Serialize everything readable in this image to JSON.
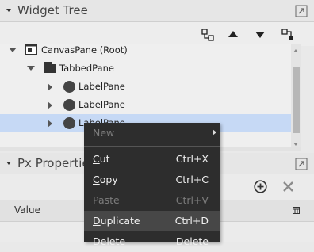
{
  "widget_tree": {
    "title": "Widget Tree",
    "toolbar_icons": [
      "expand-collapse-icon",
      "move-up-icon",
      "move-down-icon",
      "reorder-icon"
    ],
    "nodes": [
      {
        "label": "CanvasPane (Root)",
        "icon": "canvas-pane-icon",
        "expanded": true
      },
      {
        "label": "TabbedPane",
        "icon": "tabbed-pane-icon",
        "expanded": true
      },
      {
        "label": "LabelPane",
        "icon": "label-pane-icon",
        "expanded": false
      },
      {
        "label": "LabelPane",
        "icon": "label-pane-icon",
        "expanded": false
      },
      {
        "label": "LabelPane",
        "icon": "label-pane-icon",
        "expanded": false,
        "selected": true
      }
    ]
  },
  "px_properties": {
    "title": "Px Properties",
    "toolbar_icons": [
      "add-icon",
      "remove-icon"
    ],
    "column_header": "Value"
  },
  "context_menu": {
    "items": [
      {
        "first": "",
        "rest": "New",
        "shortcut": "",
        "disabled": true,
        "submenu": true
      },
      {
        "first": "C",
        "rest": "ut",
        "shortcut": "Ctrl+X",
        "disabled": false
      },
      {
        "first": "C",
        "rest": "opy",
        "shortcut": "Ctrl+C",
        "disabled": false
      },
      {
        "first": "",
        "rest": "Paste",
        "shortcut": "Ctrl+V",
        "disabled": true
      },
      {
        "first": "D",
        "rest": "uplicate",
        "shortcut": "Ctrl+D",
        "disabled": false,
        "hover": true
      },
      {
        "first": "",
        "rest": "Delete",
        "shortcut": "Delete",
        "disabled": false
      }
    ]
  },
  "colors": {
    "menu_background": "#2d2d2d",
    "selection": "#c6d9f5",
    "disabled_text": "#7c7c7c"
  }
}
